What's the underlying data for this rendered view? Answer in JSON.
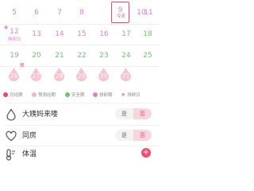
{
  "calendar": {
    "row1": [
      {
        "day": "5",
        "type": "safe"
      },
      {
        "day": "6",
        "type": "safe"
      },
      {
        "day": "7",
        "type": "safe"
      },
      {
        "day": "8",
        "type": "ovu"
      },
      {
        "day": "9",
        "type": "ovu",
        "today_label": "今天"
      },
      {
        "day": "10",
        "type": "ovu"
      },
      {
        "day": "11",
        "type": "ovu"
      }
    ],
    "row2": [
      {
        "day": "12",
        "type": "ovu",
        "tag": "排卵日"
      },
      {
        "day": "13",
        "type": "ovu"
      },
      {
        "day": "14",
        "type": "ovu"
      },
      {
        "day": "15",
        "type": "ovu"
      },
      {
        "day": "16",
        "type": "ovu"
      },
      {
        "day": "17",
        "type": "safe"
      },
      {
        "day": "18",
        "type": "safe"
      }
    ],
    "row3": [
      {
        "day": "19",
        "type": "safe"
      },
      {
        "day": "20",
        "type": "safe"
      },
      {
        "day": "21",
        "type": "safe"
      },
      {
        "day": "22",
        "type": "safe"
      },
      {
        "day": "23",
        "type": "safe"
      },
      {
        "day": "24",
        "type": "safe"
      },
      {
        "day": "25",
        "type": "safe"
      }
    ],
    "row4": [
      {
        "day": "26",
        "type": "period",
        "badge": "预"
      },
      {
        "day": "27",
        "type": "period"
      },
      {
        "day": "28",
        "type": "period"
      },
      {
        "day": "29",
        "type": "period"
      },
      {
        "day": "30",
        "type": "period"
      },
      {
        "day": "31",
        "type": "period"
      }
    ]
  },
  "legend": [
    {
      "label": "月经期",
      "color": "#f0446f"
    },
    {
      "label": "预测经期",
      "color": "#f6b4c4"
    },
    {
      "label": "安全期",
      "color": "#6fc56f"
    },
    {
      "label": "排卵期",
      "color": "#d981d2"
    },
    {
      "label": "排卵日",
      "color": "#d981d2",
      "icon": "star"
    }
  ],
  "records": {
    "period_arrived": {
      "label": "大姨妈来喽",
      "icon": "drop-icon",
      "yes": "是",
      "no": "否"
    },
    "intimacy": {
      "label": "同房",
      "icon": "heart-icon",
      "yes": "是",
      "no": "否"
    },
    "temperature": {
      "label": "体温",
      "icon": "thermometer-icon",
      "add": "+"
    }
  },
  "colors": {
    "accent": "#f0446f",
    "ovulation": "#d981d2",
    "safe": "#6fc56f",
    "predicted": "#f6b4c4"
  }
}
